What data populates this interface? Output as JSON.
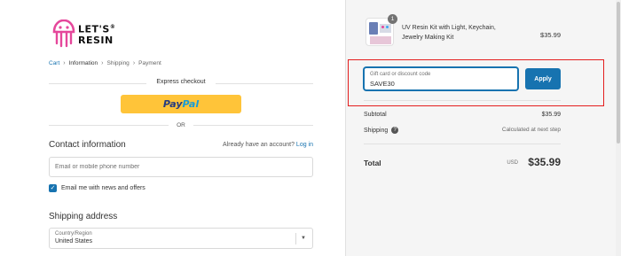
{
  "brand": {
    "name_line1": "LET'S",
    "name_line2": "RESIN",
    "registered": "®",
    "color": "#e5479b"
  },
  "breadcrumb": [
    "Cart",
    "Information",
    "Shipping",
    "Payment"
  ],
  "express": {
    "title": "Express checkout",
    "paypal_part1": "Pay",
    "paypal_part2": "Pal",
    "or_label": "OR"
  },
  "contact": {
    "title": "Contact information",
    "have_account": "Already have an account?",
    "login_link": "Log in",
    "email_placeholder": "Email or mobile phone number",
    "newsletter_label": "Email me with news and offers",
    "newsletter_checked": true
  },
  "shipping": {
    "title": "Shipping address",
    "country_label": "Country/Region",
    "country_value": "United States"
  },
  "order": {
    "product_name": "UV Resin Kit with Light, Keychain, Jewelry Making Kit",
    "product_qty": "1",
    "product_price": "$35.99",
    "discount_label": "Gift card or discount code",
    "discount_value": "SAVE30",
    "apply_label": "Apply",
    "subtotal_label": "Subtotal",
    "subtotal_value": "$35.99",
    "shipping_label": "Shipping",
    "shipping_value": "Calculated at next step",
    "total_label": "Total",
    "total_currency": "USD",
    "total_value": "$35.99"
  },
  "colors": {
    "accent": "#1773b0",
    "paypal_yellow": "#ffc439",
    "highlight": "#e41e1e"
  }
}
